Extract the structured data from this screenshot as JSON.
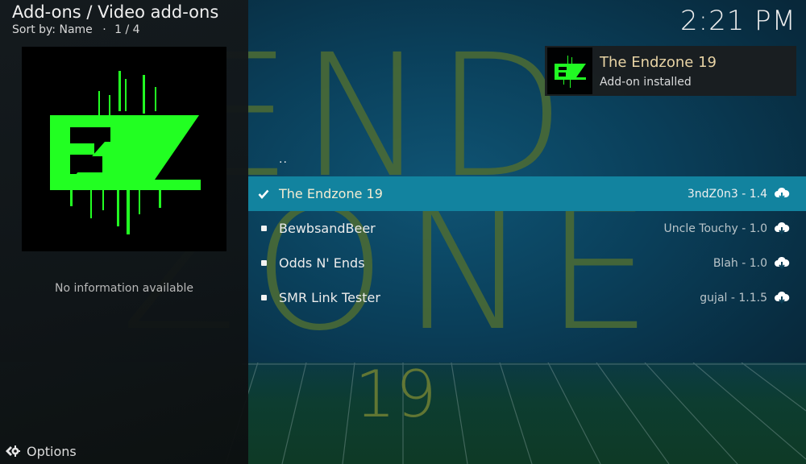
{
  "header": {
    "title": "Add-ons / Video add-ons",
    "sort_label": "Sort by: Name",
    "separator": "·",
    "page": "1 / 4",
    "subtitle": "Sort by: Name  ·  1 / 4"
  },
  "clock": "2:21 PM",
  "info_panel": {
    "thumbnail_icon": "endzone-logo",
    "thumbnail_text": "EZ",
    "description": "No information available"
  },
  "notification": {
    "icon": "endzone-logo",
    "title": "The Endzone 19",
    "message": "Add-on installed"
  },
  "background": {
    "text_end": "END",
    "text_zone": "ZONE",
    "text_number": "19"
  },
  "list": {
    "parent_label": "..",
    "items": [
      {
        "name": "The Endzone 19",
        "meta": "3ndZ0n3 - 1.4",
        "status_icon": "check-icon",
        "action_icon": "download-cloud-icon",
        "selected": true
      },
      {
        "name": "BewbsandBeer",
        "meta": "Uncle Touchy - 1.0",
        "status_icon": "bullet-icon",
        "action_icon": "download-cloud-icon",
        "selected": false
      },
      {
        "name": "Odds N' Ends",
        "meta": "Blah - 1.0",
        "status_icon": "bullet-icon",
        "action_icon": "download-cloud-icon",
        "selected": false
      },
      {
        "name": "SMR Link Tester",
        "meta": "gujal - 1.1.5",
        "status_icon": "bullet-icon",
        "action_icon": "download-cloud-icon",
        "selected": false
      }
    ]
  },
  "footer": {
    "options_label": "Options",
    "options_icon": "options-gear-icon"
  },
  "colors": {
    "selection": "#12839f",
    "logo_green": "#22ff22",
    "notification_title": "#f0d9a8"
  }
}
